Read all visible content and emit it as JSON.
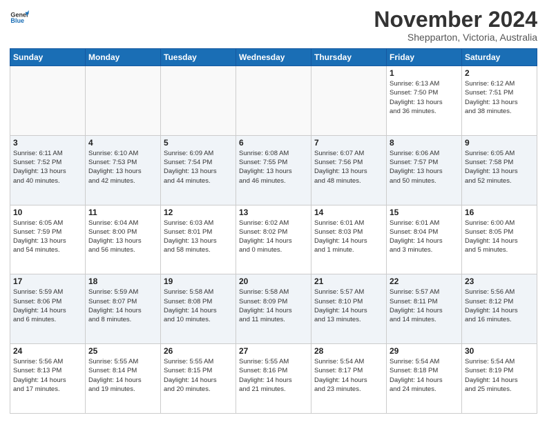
{
  "header": {
    "logo_line1": "General",
    "logo_line2": "Blue",
    "month": "November 2024",
    "location": "Shepparton, Victoria, Australia"
  },
  "weekdays": [
    "Sunday",
    "Monday",
    "Tuesday",
    "Wednesday",
    "Thursday",
    "Friday",
    "Saturday"
  ],
  "weeks": [
    [
      {
        "day": "",
        "info": ""
      },
      {
        "day": "",
        "info": ""
      },
      {
        "day": "",
        "info": ""
      },
      {
        "day": "",
        "info": ""
      },
      {
        "day": "",
        "info": ""
      },
      {
        "day": "1",
        "info": "Sunrise: 6:13 AM\nSunset: 7:50 PM\nDaylight: 13 hours\nand 36 minutes."
      },
      {
        "day": "2",
        "info": "Sunrise: 6:12 AM\nSunset: 7:51 PM\nDaylight: 13 hours\nand 38 minutes."
      }
    ],
    [
      {
        "day": "3",
        "info": "Sunrise: 6:11 AM\nSunset: 7:52 PM\nDaylight: 13 hours\nand 40 minutes."
      },
      {
        "day": "4",
        "info": "Sunrise: 6:10 AM\nSunset: 7:53 PM\nDaylight: 13 hours\nand 42 minutes."
      },
      {
        "day": "5",
        "info": "Sunrise: 6:09 AM\nSunset: 7:54 PM\nDaylight: 13 hours\nand 44 minutes."
      },
      {
        "day": "6",
        "info": "Sunrise: 6:08 AM\nSunset: 7:55 PM\nDaylight: 13 hours\nand 46 minutes."
      },
      {
        "day": "7",
        "info": "Sunrise: 6:07 AM\nSunset: 7:56 PM\nDaylight: 13 hours\nand 48 minutes."
      },
      {
        "day": "8",
        "info": "Sunrise: 6:06 AM\nSunset: 7:57 PM\nDaylight: 13 hours\nand 50 minutes."
      },
      {
        "day": "9",
        "info": "Sunrise: 6:05 AM\nSunset: 7:58 PM\nDaylight: 13 hours\nand 52 minutes."
      }
    ],
    [
      {
        "day": "10",
        "info": "Sunrise: 6:05 AM\nSunset: 7:59 PM\nDaylight: 13 hours\nand 54 minutes."
      },
      {
        "day": "11",
        "info": "Sunrise: 6:04 AM\nSunset: 8:00 PM\nDaylight: 13 hours\nand 56 minutes."
      },
      {
        "day": "12",
        "info": "Sunrise: 6:03 AM\nSunset: 8:01 PM\nDaylight: 13 hours\nand 58 minutes."
      },
      {
        "day": "13",
        "info": "Sunrise: 6:02 AM\nSunset: 8:02 PM\nDaylight: 14 hours\nand 0 minutes."
      },
      {
        "day": "14",
        "info": "Sunrise: 6:01 AM\nSunset: 8:03 PM\nDaylight: 14 hours\nand 1 minute."
      },
      {
        "day": "15",
        "info": "Sunrise: 6:01 AM\nSunset: 8:04 PM\nDaylight: 14 hours\nand 3 minutes."
      },
      {
        "day": "16",
        "info": "Sunrise: 6:00 AM\nSunset: 8:05 PM\nDaylight: 14 hours\nand 5 minutes."
      }
    ],
    [
      {
        "day": "17",
        "info": "Sunrise: 5:59 AM\nSunset: 8:06 PM\nDaylight: 14 hours\nand 6 minutes."
      },
      {
        "day": "18",
        "info": "Sunrise: 5:59 AM\nSunset: 8:07 PM\nDaylight: 14 hours\nand 8 minutes."
      },
      {
        "day": "19",
        "info": "Sunrise: 5:58 AM\nSunset: 8:08 PM\nDaylight: 14 hours\nand 10 minutes."
      },
      {
        "day": "20",
        "info": "Sunrise: 5:58 AM\nSunset: 8:09 PM\nDaylight: 14 hours\nand 11 minutes."
      },
      {
        "day": "21",
        "info": "Sunrise: 5:57 AM\nSunset: 8:10 PM\nDaylight: 14 hours\nand 13 minutes."
      },
      {
        "day": "22",
        "info": "Sunrise: 5:57 AM\nSunset: 8:11 PM\nDaylight: 14 hours\nand 14 minutes."
      },
      {
        "day": "23",
        "info": "Sunrise: 5:56 AM\nSunset: 8:12 PM\nDaylight: 14 hours\nand 16 minutes."
      }
    ],
    [
      {
        "day": "24",
        "info": "Sunrise: 5:56 AM\nSunset: 8:13 PM\nDaylight: 14 hours\nand 17 minutes."
      },
      {
        "day": "25",
        "info": "Sunrise: 5:55 AM\nSunset: 8:14 PM\nDaylight: 14 hours\nand 19 minutes."
      },
      {
        "day": "26",
        "info": "Sunrise: 5:55 AM\nSunset: 8:15 PM\nDaylight: 14 hours\nand 20 minutes."
      },
      {
        "day": "27",
        "info": "Sunrise: 5:55 AM\nSunset: 8:16 PM\nDaylight: 14 hours\nand 21 minutes."
      },
      {
        "day": "28",
        "info": "Sunrise: 5:54 AM\nSunset: 8:17 PM\nDaylight: 14 hours\nand 23 minutes."
      },
      {
        "day": "29",
        "info": "Sunrise: 5:54 AM\nSunset: 8:18 PM\nDaylight: 14 hours\nand 24 minutes."
      },
      {
        "day": "30",
        "info": "Sunrise: 5:54 AM\nSunset: 8:19 PM\nDaylight: 14 hours\nand 25 minutes."
      }
    ]
  ]
}
